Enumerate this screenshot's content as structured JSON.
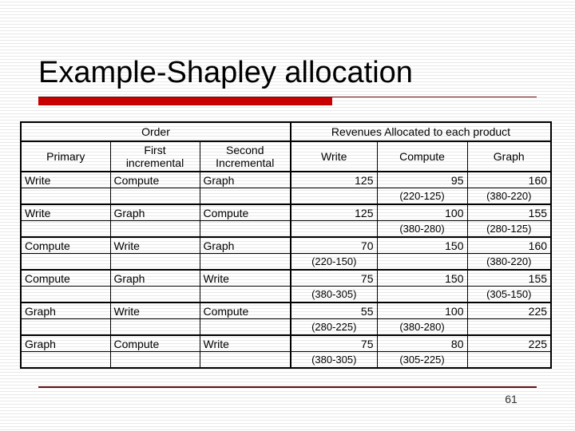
{
  "slide": {
    "title": "Example-Shapley allocation",
    "page_number": "61",
    "accent_color": "#cc0000",
    "rule_color": "#6b1010"
  },
  "table": {
    "group_headers": {
      "order": "Order",
      "revenues": "Revenues Allocated to each product"
    },
    "columns": [
      {
        "key": "primary",
        "label": "Primary"
      },
      {
        "key": "first",
        "label_line1": "First",
        "label_line2": "incremental"
      },
      {
        "key": "second",
        "label_line1": "Second",
        "label_line2": "Incremental"
      },
      {
        "key": "write",
        "label": "Write"
      },
      {
        "key": "compute",
        "label": "Compute"
      },
      {
        "key": "graph",
        "label": "Graph"
      }
    ],
    "rows": [
      {
        "primary": "Write",
        "first": "Compute",
        "second": "Graph",
        "write": "125",
        "compute": "95",
        "graph": "160",
        "write_calc": "",
        "compute_calc": "(220-125)",
        "graph_calc": "(380-220)"
      },
      {
        "primary": "Write",
        "first": "Graph",
        "second": "Compute",
        "write": "125",
        "compute": "100",
        "graph": "155",
        "write_calc": "",
        "compute_calc": "(380-280)",
        "graph_calc": "(280-125)"
      },
      {
        "primary": "Compute",
        "first": "Write",
        "second": "Graph",
        "write": "70",
        "compute": "150",
        "graph": "160",
        "write_calc": "(220-150)",
        "compute_calc": "",
        "graph_calc": "(380-220)"
      },
      {
        "primary": "Compute",
        "first": "Graph",
        "second": "Write",
        "write": "75",
        "compute": "150",
        "graph": "155",
        "write_calc": "(380-305)",
        "compute_calc": "",
        "graph_calc": "(305-150)"
      },
      {
        "primary": "Graph",
        "first": "Write",
        "second": "Compute",
        "write": "55",
        "compute": "100",
        "graph": "225",
        "write_calc": "(280-225)",
        "compute_calc": "(380-280)",
        "graph_calc": ""
      },
      {
        "primary": "Graph",
        "first": "Compute",
        "second": "Write",
        "write": "75",
        "compute": "80",
        "graph": "225",
        "write_calc": "(380-305)",
        "compute_calc": "(305-225)",
        "graph_calc": ""
      }
    ]
  }
}
